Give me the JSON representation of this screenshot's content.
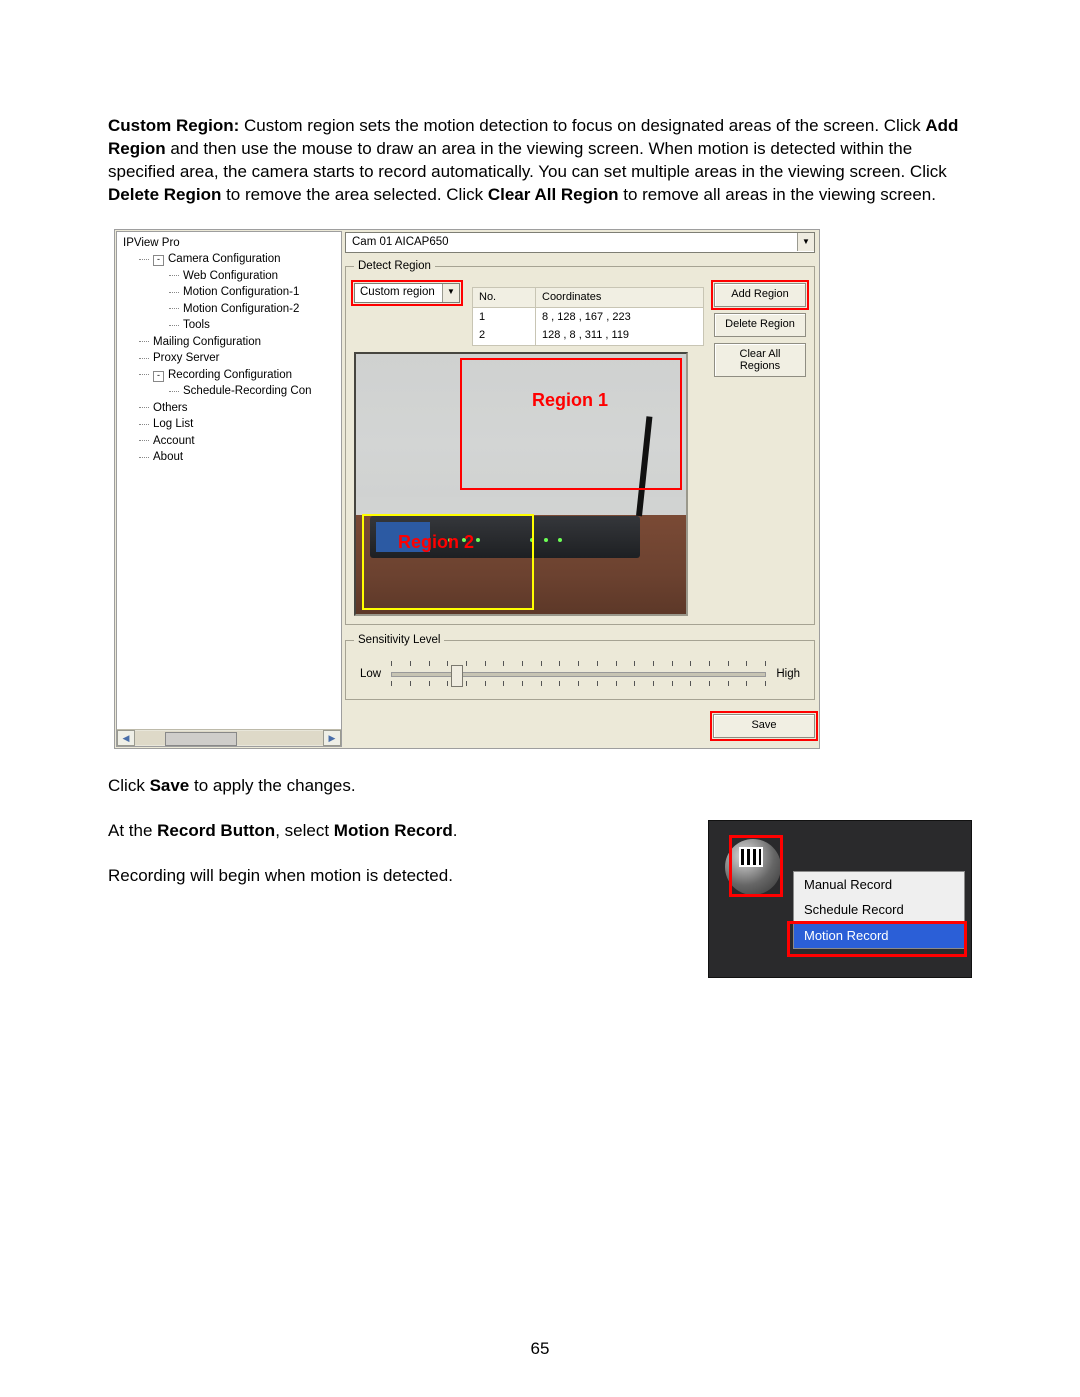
{
  "paragraph1": {
    "bold1": "Custom Region:",
    "t1": " Custom region sets the motion detection to focus on designated areas of the screen. Click ",
    "bold2": "Add Region",
    "t2": " and then use the mouse to draw an area in the viewing screen. When motion is detected within the specified area, the camera starts to record automatically. You can set multiple areas in the viewing screen. Click ",
    "bold3": "Delete Region",
    "t3": " to remove the area selected. Click ",
    "bold4": "Clear All Region",
    "t4": " to remove all areas in the viewing screen."
  },
  "app": {
    "root": "IPView Pro",
    "tree": {
      "camera_config": "Camera Configuration",
      "web_config": "Web Configuration",
      "motion1": "Motion Configuration-1",
      "motion2": "Motion Configuration-2",
      "tools": "Tools",
      "mailing": "Mailing Configuration",
      "proxy": "Proxy Server",
      "recording": "Recording Configuration",
      "schedule_rec": "Schedule-Recording Con",
      "others": "Others",
      "loglist": "Log List",
      "account": "Account",
      "about": "About"
    },
    "camera_selected": "Cam 01    AICAP650",
    "detect_legend": "Detect Region",
    "region_mode": "Custom region",
    "table": {
      "hdr_no": "No.",
      "hdr_coord": "Coordinates",
      "rows": [
        {
          "no": "1",
          "coord": "8 , 128 , 167 , 223"
        },
        {
          "no": "2",
          "coord": "128 , 8 , 311 , 119"
        }
      ]
    },
    "btn_add": "Add Region",
    "btn_delete": "Delete Region",
    "btn_clear1": "Clear All",
    "btn_clear2": "Regions",
    "region1_label": "Region 1",
    "region2_label": "Region 2",
    "sens_legend": "Sensitivity Level",
    "sens_low": "Low",
    "sens_high": "High",
    "btn_save": "Save"
  },
  "paragraph2": {
    "t1": "Click ",
    "b1": "Save",
    "t2": " to apply the changes."
  },
  "paragraph3": {
    "t1": "At the ",
    "b1": "Record Button",
    "t2": ", select ",
    "b2": "Motion Record",
    "t3": "."
  },
  "paragraph4": "Recording will begin when motion is detected.",
  "menu": {
    "item1": "Manual Record",
    "item2": "Schedule Record",
    "item3": "Motion Record"
  },
  "page_number": "65"
}
